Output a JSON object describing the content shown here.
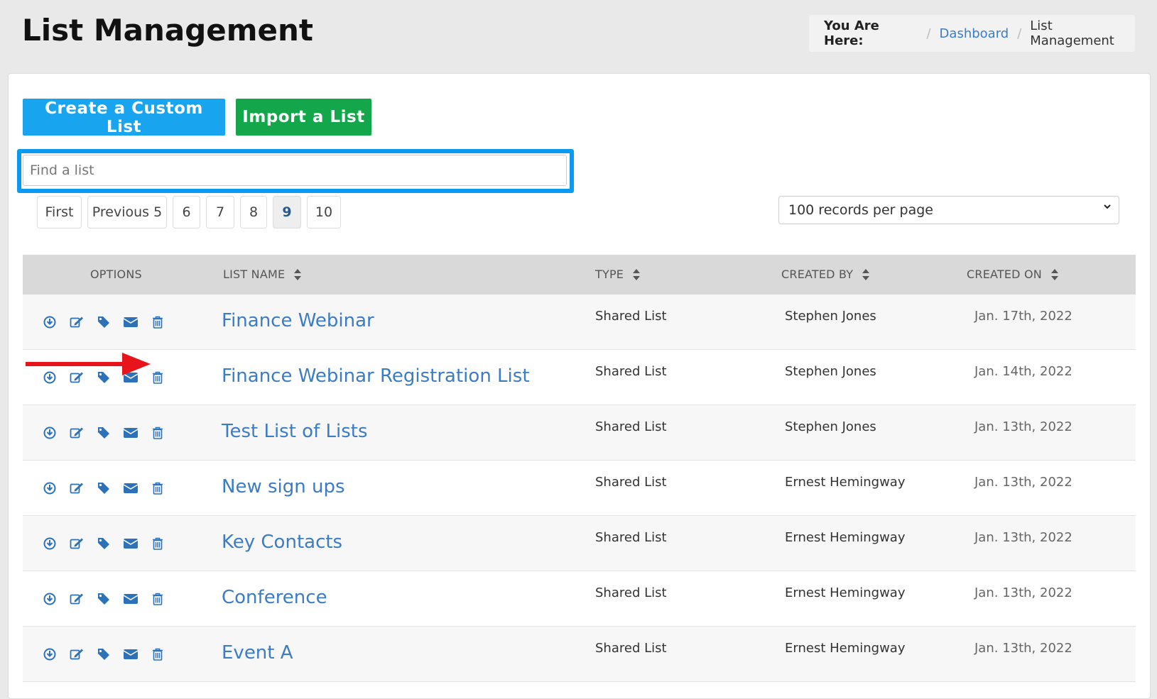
{
  "header": {
    "title": "List Management",
    "breadcrumb": {
      "label": "You Are Here:",
      "links": [
        "Dashboard"
      ],
      "current": "List Management"
    }
  },
  "actions": {
    "create_label": "Create a Custom List",
    "import_label": "Import a List"
  },
  "colors": {
    "create_button": "#18a4ee",
    "import_button": "#13a64a",
    "link": "#3b7cc4",
    "search_highlight": "#0a9bf0",
    "annotation_arrow": "#e8141c"
  },
  "search": {
    "placeholder": "Find a list",
    "value": ""
  },
  "pagination": {
    "items": [
      "First",
      "Previous 5",
      "6",
      "7",
      "8",
      "9",
      "10"
    ],
    "active": "9"
  },
  "per_page": {
    "selected": "100 records per page"
  },
  "table": {
    "columns": [
      "OPTIONS",
      "LIST NAME",
      "TYPE",
      "CREATED BY",
      "CREATED ON"
    ],
    "option_icons": [
      "download-icon",
      "edit-icon",
      "tag-icon",
      "envelope-icon",
      "trash-icon"
    ],
    "rows": [
      {
        "name": "Finance Webinar",
        "type": "Shared List",
        "created_by": "Stephen Jones",
        "created_on": "Jan. 17th, 2022"
      },
      {
        "name": "Finance Webinar Registration List",
        "type": "Shared List",
        "created_by": "Stephen Jones",
        "created_on": "Jan. 14th, 2022"
      },
      {
        "name": "Test List of Lists",
        "type": "Shared List",
        "created_by": "Stephen Jones",
        "created_on": "Jan. 13th, 2022"
      },
      {
        "name": "New sign ups",
        "type": "Shared List",
        "created_by": "Ernest Hemingway",
        "created_on": "Jan. 13th, 2022"
      },
      {
        "name": "Key Contacts",
        "type": "Shared List",
        "created_by": "Ernest Hemingway",
        "created_on": "Jan. 13th, 2022"
      },
      {
        "name": "Conference",
        "type": "Shared List",
        "created_by": "Ernest Hemingway",
        "created_on": "Jan. 13th, 2022"
      },
      {
        "name": "Event A",
        "type": "Shared List",
        "created_by": "Ernest Hemingway",
        "created_on": "Jan. 13th, 2022"
      }
    ]
  }
}
